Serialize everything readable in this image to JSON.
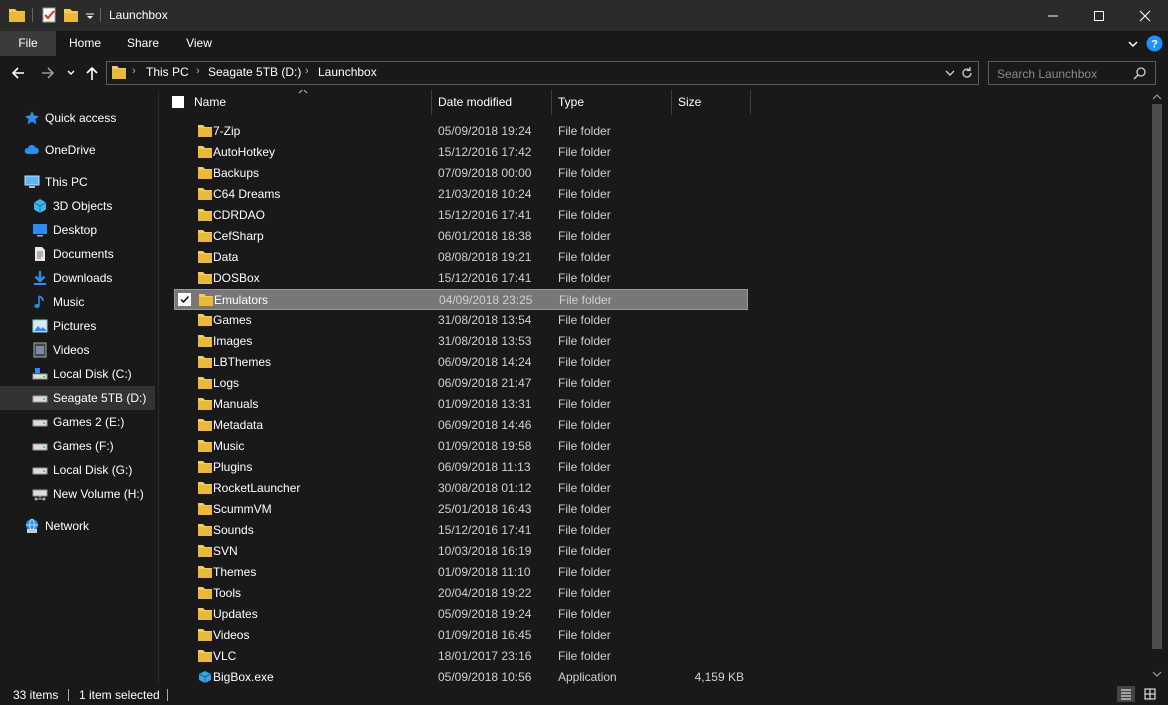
{
  "window": {
    "title": "Launchbox",
    "colors": {
      "background": "#191919",
      "titlebar": "#2b2b2b",
      "folder_yellow": "#f4cc56",
      "accent_blue": "#1e90ff",
      "selected_row": "#777777"
    }
  },
  "quick_access_toolbar": {
    "icons": [
      "folder-icon",
      "properties-icon",
      "new-folder-icon",
      "customize-qat-icon"
    ]
  },
  "window_controls": {
    "icons": [
      "minimize-icon",
      "maximize-icon",
      "close-icon"
    ]
  },
  "ribbon": {
    "tabs": [
      {
        "label": "File",
        "active": true
      },
      {
        "label": "Home"
      },
      {
        "label": "Share"
      },
      {
        "label": "View"
      }
    ]
  },
  "address_bar": {
    "breadcrumbs": [
      "This PC",
      "Seagate 5TB (D:)",
      "Launchbox"
    ],
    "separator": "›"
  },
  "search": {
    "placeholder": "Search Launchbox"
  },
  "nav_pane": {
    "items": [
      {
        "label": "Quick access",
        "icon": "star-icon",
        "indent": 0
      },
      {
        "label": "OneDrive",
        "icon": "cloud-icon",
        "indent": 0
      },
      {
        "label": "This PC",
        "icon": "computer-icon",
        "indent": 0
      },
      {
        "label": "3D Objects",
        "icon": "cube-icon",
        "indent": 1
      },
      {
        "label": "Desktop",
        "icon": "desktop-icon",
        "indent": 1
      },
      {
        "label": "Documents",
        "icon": "document-icon",
        "indent": 1
      },
      {
        "label": "Downloads",
        "icon": "download-icon",
        "indent": 1
      },
      {
        "label": "Music",
        "icon": "music-icon",
        "indent": 1
      },
      {
        "label": "Pictures",
        "icon": "pictures-icon",
        "indent": 1
      },
      {
        "label": "Videos",
        "icon": "video-icon",
        "indent": 1
      },
      {
        "label": "Local Disk (C:)",
        "icon": "drive-icon",
        "indent": 1
      },
      {
        "label": "Seagate 5TB (D:)",
        "icon": "drive-icon",
        "indent": 1,
        "selected": true
      },
      {
        "label": "Games 2 (E:)",
        "icon": "drive-icon",
        "indent": 1
      },
      {
        "label": "Games (F:)",
        "icon": "drive-icon",
        "indent": 1
      },
      {
        "label": "Local Disk (G:)",
        "icon": "drive-icon",
        "indent": 1
      },
      {
        "label": "New Volume (H:)",
        "icon": "network-drive-icon",
        "indent": 1
      },
      {
        "label": "Network",
        "icon": "network-icon",
        "indent": 0
      }
    ]
  },
  "file_list": {
    "columns": {
      "name": "Name",
      "date": "Date modified",
      "type": "Type",
      "size": "Size"
    },
    "rows": [
      {
        "name": "7-Zip",
        "date": "05/09/2018 19:24",
        "type": "File folder",
        "size": ""
      },
      {
        "name": "AutoHotkey",
        "date": "15/12/2016 17:42",
        "type": "File folder",
        "size": ""
      },
      {
        "name": "Backups",
        "date": "07/09/2018 00:00",
        "type": "File folder",
        "size": ""
      },
      {
        "name": "C64 Dreams",
        "date": "21/03/2018 10:24",
        "type": "File folder",
        "size": ""
      },
      {
        "name": "CDRDAO",
        "date": "15/12/2016 17:41",
        "type": "File folder",
        "size": ""
      },
      {
        "name": "CefSharp",
        "date": "06/01/2018 18:38",
        "type": "File folder",
        "size": ""
      },
      {
        "name": "Data",
        "date": "08/08/2018 19:21",
        "type": "File folder",
        "size": ""
      },
      {
        "name": "DOSBox",
        "date": "15/12/2016 17:41",
        "type": "File folder",
        "size": ""
      },
      {
        "name": "Emulators",
        "date": "04/09/2018 23:25",
        "type": "File folder",
        "size": "",
        "selected": true
      },
      {
        "name": "Games",
        "date": "31/08/2018 13:54",
        "type": "File folder",
        "size": ""
      },
      {
        "name": "Images",
        "date": "31/08/2018 13:53",
        "type": "File folder",
        "size": ""
      },
      {
        "name": "LBThemes",
        "date": "06/09/2018 14:24",
        "type": "File folder",
        "size": ""
      },
      {
        "name": "Logs",
        "date": "06/09/2018 21:47",
        "type": "File folder",
        "size": ""
      },
      {
        "name": "Manuals",
        "date": "01/09/2018 13:31",
        "type": "File folder",
        "size": ""
      },
      {
        "name": "Metadata",
        "date": "06/09/2018 14:46",
        "type": "File folder",
        "size": ""
      },
      {
        "name": "Music",
        "date": "01/09/2018 19:58",
        "type": "File folder",
        "size": ""
      },
      {
        "name": "Plugins",
        "date": "06/09/2018 11:13",
        "type": "File folder",
        "size": ""
      },
      {
        "name": "RocketLauncher",
        "date": "30/08/2018 01:12",
        "type": "File folder",
        "size": ""
      },
      {
        "name": "ScummVM",
        "date": "25/01/2018 16:43",
        "type": "File folder",
        "size": ""
      },
      {
        "name": "Sounds",
        "date": "15/12/2016 17:41",
        "type": "File folder",
        "size": ""
      },
      {
        "name": "SVN",
        "date": "10/03/2018 16:19",
        "type": "File folder",
        "size": ""
      },
      {
        "name": "Themes",
        "date": "01/09/2018 11:10",
        "type": "File folder",
        "size": ""
      },
      {
        "name": "Tools",
        "date": "20/04/2018 19:22",
        "type": "File folder",
        "size": ""
      },
      {
        "name": "Updates",
        "date": "05/09/2018 19:24",
        "type": "File folder",
        "size": ""
      },
      {
        "name": "Videos",
        "date": "01/09/2018 16:45",
        "type": "File folder",
        "size": ""
      },
      {
        "name": "VLC",
        "date": "18/01/2017 23:16",
        "type": "File folder",
        "size": ""
      },
      {
        "name": "BigBox.exe",
        "date": "05/09/2018 10:56",
        "type": "Application",
        "size": "4,159 KB",
        "icon": "application-icon"
      }
    ]
  },
  "status_bar": {
    "item_count": "33 items",
    "selection": "1 item selected"
  }
}
